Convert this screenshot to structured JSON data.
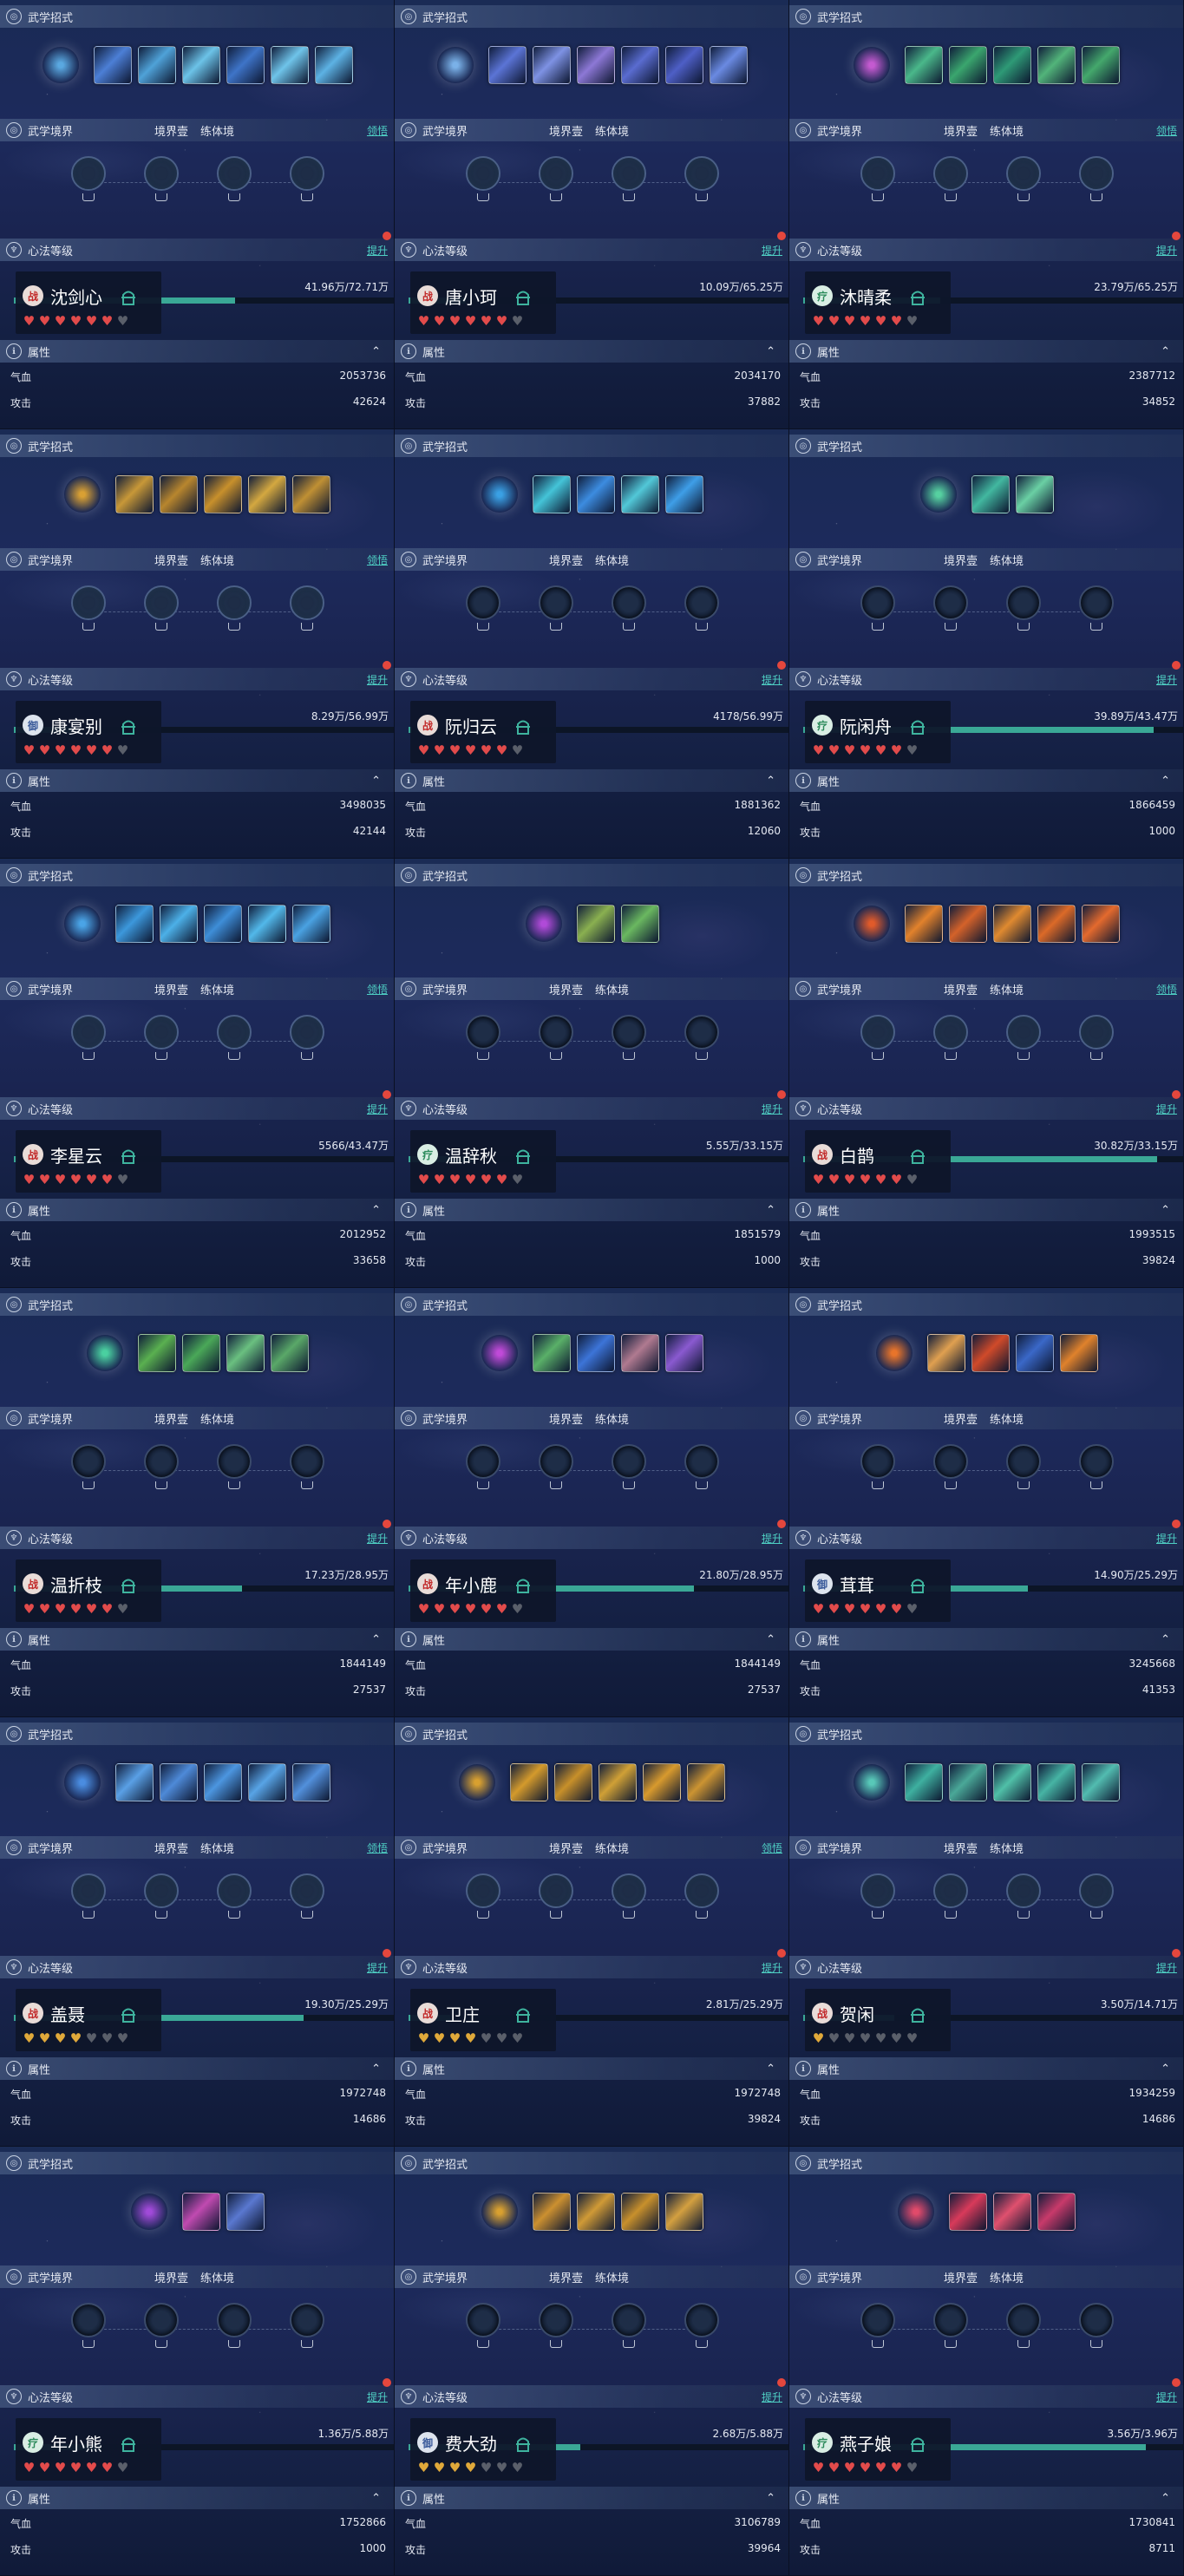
{
  "labels": {
    "skill_section": "武学招式",
    "realm_section": "武学境界",
    "realm_sub1": "境界壹",
    "realm_sub2": "练体境",
    "realm_action": "领悟",
    "heart_section": "心法等级",
    "heart_action": "提升",
    "attr_section": "属性",
    "stat_hp": "气血",
    "stat_atk": "攻击"
  },
  "faction_glyphs": {
    "war": "战",
    "heal": "疗",
    "guard": "御"
  },
  "colors": {
    "accent": "#4fd1c5",
    "bar_fill": "#3aa896",
    "alert_dot": "#e4473d",
    "heart_red": "#e24b4b",
    "heart_gold": "#e0a93a",
    "heart_grey": "#5a5f6a"
  },
  "panels": [
    {
      "name": "沈剑心",
      "faction": "war",
      "progress": "41.96万/72.71万",
      "fill": 0.58,
      "hp": "2053736",
      "atk": "42624",
      "hearts": "redred",
      "skills": [
        "#5aa8e0",
        "#4c7fd6",
        "#4fa2d8",
        "#6cc3e8",
        "#3e74c8",
        "#6fc4ea",
        "#5db2e4"
      ],
      "realms": [
        1,
        1,
        1,
        1
      ],
      "realm_action": true
    },
    {
      "name": "唐小珂",
      "faction": "war",
      "progress": "10.09万/65.25万",
      "fill": 0.15,
      "hp": "2034170",
      "atk": "37882",
      "hearts": "redred",
      "skills": [
        "#7ab1e8",
        "#5b74d6",
        "#7e92e4",
        "#8d78d6",
        "#5a6cd0",
        "#4e5fc6",
        "#6a8ae2"
      ],
      "realms": [
        1,
        1,
        1,
        1
      ],
      "realm_action": false
    },
    {
      "name": "沐晴柔",
      "faction": "heal",
      "progress": "23.79万/65.25万",
      "fill": 0.36,
      "hp": "2387712",
      "atk": "34852",
      "hearts": "redred",
      "skills": [
        "#c45ad0",
        "#4ab88a",
        "#3aa66e",
        "#2e9a76",
        "#52b47a",
        "#44a86c"
      ],
      "realms": [
        1,
        1,
        1,
        1
      ],
      "realm_action": true
    },
    {
      "name": "康宴别",
      "faction": "guard",
      "progress": "8.29万/56.99万",
      "fill": 0.15,
      "hp": "3498035",
      "atk": "42144",
      "hearts": "redred",
      "skills": [
        "#d9a033",
        "#c89838",
        "#b8862e",
        "#c8902c",
        "#d4a840",
        "#c09034"
      ],
      "realms": [
        1,
        1,
        1,
        1
      ],
      "realm_action": true
    },
    {
      "name": "阮归云",
      "faction": "war",
      "progress": "4178/56.99万",
      "fill": 0.01,
      "hp": "1881362",
      "atk": "12060",
      "hearts": "redred",
      "skills": [
        "#3aa0e4",
        "#44c4d8",
        "#3c8ce0",
        "#52c8d8",
        "#3e9ee8"
      ],
      "realms": [
        0,
        0,
        0,
        0
      ],
      "realm_action": false
    },
    {
      "name": "阮闲舟",
      "faction": "heal",
      "progress": "39.89万/43.47万",
      "fill": 0.92,
      "hp": "1866459",
      "atk": "1000",
      "hearts": "redred",
      "skills": [
        "#56d0a0",
        "#42b8a0",
        "#6ad0a4"
      ],
      "realms": [
        0,
        0,
        0,
        0
      ],
      "realm_action": false
    },
    {
      "name": "李星云",
      "faction": "war",
      "progress": "5566/43.47万",
      "fill": 0.01,
      "hp": "2012952",
      "atk": "33658",
      "hearts": "redred",
      "skills": [
        "#4aa4e6",
        "#3c98dc",
        "#4cb0e8",
        "#3e8ed8",
        "#52b8ea",
        "#4aa2e2"
      ],
      "realms": [
        1,
        1,
        1,
        1
      ],
      "realm_action": true
    },
    {
      "name": "温辞秋",
      "faction": "heal",
      "progress": "5.55万/33.15万",
      "fill": 0.17,
      "hp": "1851579",
      "atk": "1000",
      "hearts": "redred",
      "skills": [
        "#b04ad8",
        "#8ab050",
        "#6ab860"
      ],
      "realms": [
        0,
        0,
        0,
        0
      ],
      "realm_action": false
    },
    {
      "name": "白鹊",
      "faction": "war",
      "progress": "30.82万/33.15万",
      "fill": 0.93,
      "hp": "1993515",
      "atk": "39824",
      "hearts": "redred",
      "skills": [
        "#e05a2a",
        "#e2822c",
        "#d4622a",
        "#e08a30",
        "#dc6a28",
        "#e46a2e"
      ],
      "realms": [
        1,
        1,
        1,
        1
      ],
      "realm_action": true
    },
    {
      "name": "温折枝",
      "faction": "war",
      "progress": "17.23万/28.95万",
      "fill": 0.6,
      "hp": "1844149",
      "atk": "27537",
      "hearts": "redred",
      "skills": [
        "#4ad0a0",
        "#5ab050",
        "#4aa858",
        "#6ac080",
        "#5aa868"
      ],
      "realms": [
        0,
        0,
        0,
        0
      ],
      "realm_action": false
    },
    {
      "name": "年小鹿",
      "faction": "war",
      "progress": "21.80万/28.95万",
      "fill": 0.75,
      "hp": "1844149",
      "atk": "27537",
      "hearts": "redred",
      "skills": [
        "#c04ad8",
        "#5ab068",
        "#3c74d8",
        "#b07a90",
        "#8a5ad0"
      ],
      "realms": [
        0,
        0,
        0,
        0
      ],
      "realm_action": false
    },
    {
      "name": "茸茸",
      "faction": "guard",
      "progress": "14.90万/25.29万",
      "fill": 0.59,
      "hp": "3245668",
      "atk": "41353",
      "hearts": "redred",
      "skills": [
        "#e8742a",
        "#e0a050",
        "#d04a2a",
        "#3a68c8",
        "#e0822c"
      ],
      "realms": [
        0,
        0,
        0,
        0
      ],
      "realm_action": false
    },
    {
      "name": "盖聂",
      "faction": "war",
      "progress": "19.30万/25.29万",
      "fill": 0.76,
      "hp": "1972748",
      "atk": "14686",
      "hearts": "gold",
      "skills": [
        "#4a8ce0",
        "#5aa0e6",
        "#4e8ad8",
        "#4c96e0",
        "#58a4e6",
        "#5290dc"
      ],
      "realms": [
        1,
        1,
        1,
        1
      ],
      "realm_action": true
    },
    {
      "name": "卫庄",
      "faction": "war",
      "progress": "2.81万/25.29万",
      "fill": 0.11,
      "hp": "1972748",
      "atk": "39824",
      "hearts": "gold",
      "skills": [
        "#d8a030",
        "#d49a2c",
        "#c8902a",
        "#d0a036",
        "#d89a2e",
        "#cc9432"
      ],
      "realms": [
        1,
        1,
        1,
        1
      ],
      "realm_action": true
    },
    {
      "name": "贺闲",
      "faction": "war",
      "progress": "3.50万/14.71万",
      "fill": 0.24,
      "hp": "1934259",
      "atk": "14686",
      "hearts": "greyish",
      "skills": [
        "#58c8b8",
        "#3eb0a0",
        "#4aa898",
        "#50c0a8",
        "#46b4a4",
        "#52bcb0"
      ],
      "realms": [
        1,
        1,
        1,
        1
      ],
      "realm_action": false
    },
    {
      "name": "年小熊",
      "faction": "heal",
      "progress": "1.36万/5.88万",
      "fill": 0.23,
      "hp": "1752866",
      "atk": "1000",
      "hearts": "redred",
      "skills": [
        "#a04ad8",
        "#c04ab0",
        "#5a78d0"
      ],
      "realms": [
        0,
        0,
        0,
        0
      ],
      "realm_action": false
    },
    {
      "name": "费大劲",
      "faction": "guard",
      "progress": "2.68万/5.88万",
      "fill": 0.45,
      "hp": "3106789",
      "atk": "39964",
      "hearts": "gold",
      "skills": [
        "#d8a030",
        "#cc9030",
        "#d09a36",
        "#c8902c",
        "#d4a040"
      ],
      "realms": [
        0,
        0,
        0,
        0
      ],
      "realm_action": false
    },
    {
      "name": "燕子娘",
      "faction": "heal",
      "progress": "3.56万/3.96万",
      "fill": 0.9,
      "hp": "1730841",
      "atk": "8711",
      "hearts": "redred",
      "skills": [
        "#e04a6a",
        "#d83a5a",
        "#e0506e",
        "#c83a6a"
      ],
      "realms": [
        0,
        0,
        0,
        0
      ],
      "realm_action": false
    }
  ]
}
